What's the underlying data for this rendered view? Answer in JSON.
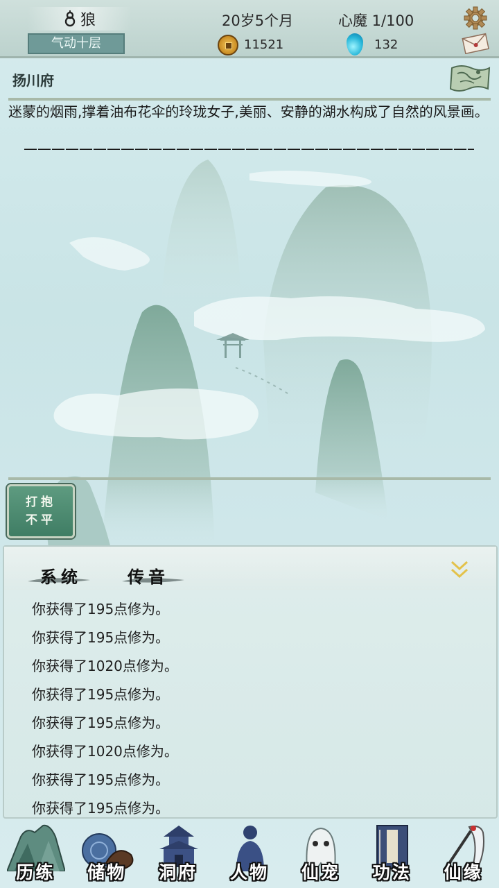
{
  "header": {
    "name": "狼",
    "realm": "气动十层",
    "age": "20岁5个月",
    "xinmo": "心魔  1/100",
    "coins": "11521",
    "gems": "132",
    "icons": [
      "gourd-icon",
      "coin-icon",
      "spirit-gem-icon",
      "gear-icon",
      "letter-icon"
    ]
  },
  "location": {
    "name": "扬川府",
    "description": "迷蒙的烟雨,撑着油布花伞的玲珑女子,美丽、安静的湖水构成了自然的风景画。",
    "divider": "—————————————————————————————————————————"
  },
  "actions": {
    "complain_line1": "打抱",
    "complain_line2": "不平"
  },
  "messages": {
    "tabs": [
      "系统",
      "传音"
    ],
    "items": [
      "你获得了195点修为。",
      "你获得了195点修为。",
      "你获得了1020点修为。",
      "你获得了195点修为。",
      "你获得了195点修为。",
      "你获得了1020点修为。",
      "你获得了195点修为。",
      "你获得了195点修为。"
    ]
  },
  "nav": {
    "items": [
      {
        "label": "历练",
        "icon": "mountain-icon"
      },
      {
        "label": "储物",
        "icon": "storage-bag-icon"
      },
      {
        "label": "洞府",
        "icon": "pagoda-icon"
      },
      {
        "label": "人物",
        "icon": "person-icon"
      },
      {
        "label": "仙宠",
        "icon": "ghost-pet-icon"
      },
      {
        "label": "功法",
        "icon": "book-icon"
      },
      {
        "label": "仙缘",
        "icon": "crane-icon"
      }
    ]
  },
  "colors": {
    "background": "#cfe7ea",
    "realm_box": "#6f9a98",
    "action_button": "#4d8c71"
  }
}
